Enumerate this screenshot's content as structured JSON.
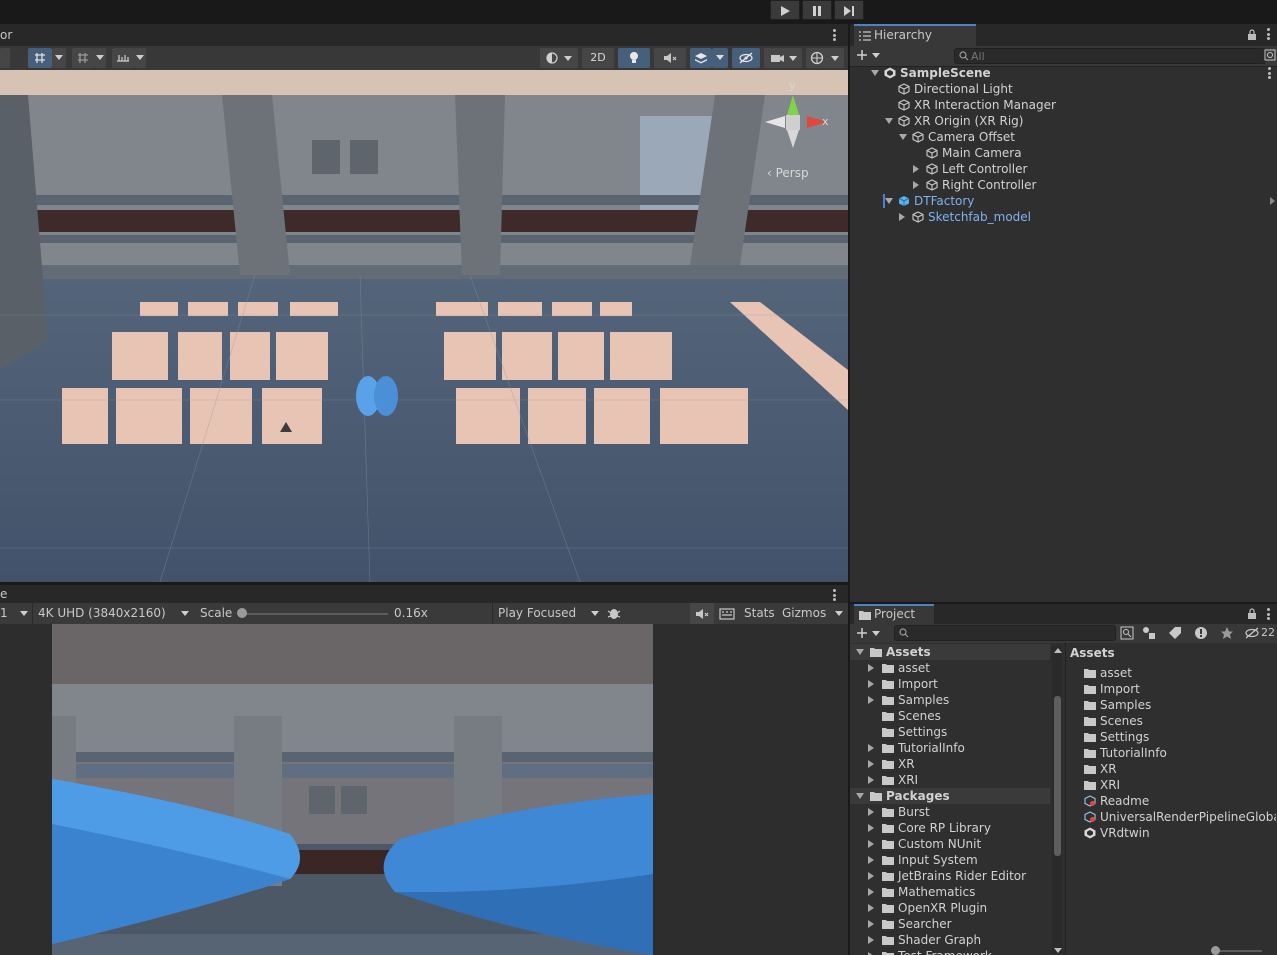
{
  "toolbar": {
    "play_icon": "play-icon",
    "pause_icon": "pause-icon",
    "step_icon": "step-icon"
  },
  "scene": {
    "tab_label": "or",
    "view_2d_label": "2D",
    "gizmo": {
      "y_label": "y",
      "x_label": "x",
      "persp_label": "‹ Persp"
    }
  },
  "game": {
    "tab_label": "e",
    "display_label": "1",
    "resolution": "4K UHD (3840x2160)",
    "scale_label": "Scale",
    "scale_value": "0.16x",
    "play_mode": "Play Focused",
    "stats_label": "Stats",
    "gizmos_label": "Gizmos"
  },
  "hierarchy": {
    "tab_label": "Hierarchy",
    "search_placeholder": "All",
    "items": [
      {
        "label": "SampleScene",
        "depth": 0,
        "arrow": "down",
        "icon": "unity-scene-icon",
        "bold": true
      },
      {
        "label": "Directional Light",
        "depth": 1,
        "arrow": "none",
        "icon": "gameobject-icon"
      },
      {
        "label": "XR Interaction Manager",
        "depth": 1,
        "arrow": "none",
        "icon": "gameobject-icon"
      },
      {
        "label": "XR Origin (XR Rig)",
        "depth": 1,
        "arrow": "down",
        "icon": "gameobject-icon"
      },
      {
        "label": "Camera Offset",
        "depth": 2,
        "arrow": "down",
        "icon": "gameobject-icon"
      },
      {
        "label": "Main Camera",
        "depth": 3,
        "arrow": "none",
        "icon": "gameobject-icon"
      },
      {
        "label": "Left Controller",
        "depth": 3,
        "arrow": "right",
        "icon": "gameobject-icon"
      },
      {
        "label": "Right Controller",
        "depth": 3,
        "arrow": "right",
        "icon": "gameobject-icon"
      },
      {
        "label": "DTFactory",
        "depth": 1,
        "arrow": "down",
        "icon": "prefab-icon",
        "prefab": true
      },
      {
        "label": "Sketchfab_model",
        "depth": 2,
        "arrow": "right",
        "icon": "gameobject-icon",
        "prefab": true
      }
    ]
  },
  "project": {
    "tab_label": "Project",
    "hidden_count": "22",
    "tree": [
      {
        "label": "Assets",
        "depth": 0,
        "arrow": "down",
        "bold": true
      },
      {
        "label": "asset",
        "depth": 1,
        "arrow": "right"
      },
      {
        "label": "Import",
        "depth": 1,
        "arrow": "right"
      },
      {
        "label": "Samples",
        "depth": 1,
        "arrow": "right"
      },
      {
        "label": "Scenes",
        "depth": 1,
        "arrow": "none"
      },
      {
        "label": "Settings",
        "depth": 1,
        "arrow": "none"
      },
      {
        "label": "TutorialInfo",
        "depth": 1,
        "arrow": "right"
      },
      {
        "label": "XR",
        "depth": 1,
        "arrow": "right"
      },
      {
        "label": "XRI",
        "depth": 1,
        "arrow": "right"
      },
      {
        "label": "Packages",
        "depth": 0,
        "arrow": "down",
        "bold": true
      },
      {
        "label": "Burst",
        "depth": 1,
        "arrow": "right"
      },
      {
        "label": "Core RP Library",
        "depth": 1,
        "arrow": "right"
      },
      {
        "label": "Custom NUnit",
        "depth": 1,
        "arrow": "right"
      },
      {
        "label": "Input System",
        "depth": 1,
        "arrow": "right"
      },
      {
        "label": "JetBrains Rider Editor",
        "depth": 1,
        "arrow": "right"
      },
      {
        "label": "Mathematics",
        "depth": 1,
        "arrow": "right"
      },
      {
        "label": "OpenXR Plugin",
        "depth": 1,
        "arrow": "right"
      },
      {
        "label": "Searcher",
        "depth": 1,
        "arrow": "right"
      },
      {
        "label": "Shader Graph",
        "depth": 1,
        "arrow": "right"
      },
      {
        "label": "Test Framework",
        "depth": 1,
        "arrow": "right"
      }
    ],
    "breadcrumb": "Assets",
    "contents": [
      {
        "label": "asset",
        "icon": "folder-icon"
      },
      {
        "label": "Import",
        "icon": "folder-icon"
      },
      {
        "label": "Samples",
        "icon": "folder-icon"
      },
      {
        "label": "Scenes",
        "icon": "folder-icon"
      },
      {
        "label": "Settings",
        "icon": "folder-icon"
      },
      {
        "label": "TutorialInfo",
        "icon": "folder-icon"
      },
      {
        "label": "XR",
        "icon": "folder-icon"
      },
      {
        "label": "XRI",
        "icon": "folder-icon"
      },
      {
        "label": "Readme",
        "icon": "scriptable-object-icon"
      },
      {
        "label": "UniversalRenderPipelineGlobalSettings",
        "icon": "scriptable-object-icon"
      },
      {
        "label": "VRdtwin",
        "icon": "unity-scene-icon"
      }
    ]
  },
  "colors": {
    "accent": "#4e81c8",
    "prefab_text": "#7fb2f0",
    "panel_bg": "#2f2f2f",
    "toolbar_bg": "#383838"
  }
}
